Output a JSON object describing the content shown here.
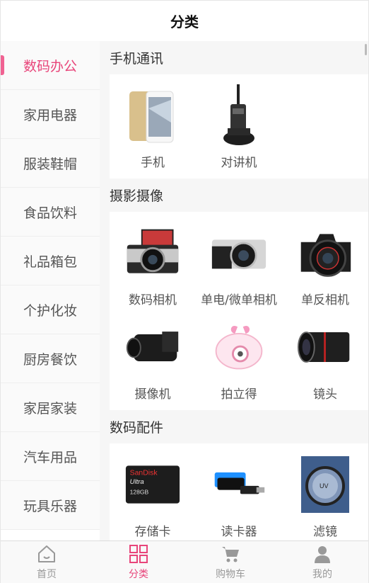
{
  "header": {
    "title": "分类"
  },
  "sidebar": {
    "items": [
      {
        "label": "数码办公",
        "active": true
      },
      {
        "label": "家用电器"
      },
      {
        "label": "服装鞋帽"
      },
      {
        "label": "食品饮料"
      },
      {
        "label": "礼品箱包"
      },
      {
        "label": "个护化妆"
      },
      {
        "label": "厨房餐饮"
      },
      {
        "label": "家居家装"
      },
      {
        "label": "汽车用品"
      },
      {
        "label": "玩具乐器"
      }
    ]
  },
  "sections": [
    {
      "title": "手机通讯",
      "items": [
        {
          "label": "手机",
          "icon": "smartphone-image"
        },
        {
          "label": "对讲机",
          "icon": "walkie-talkie-image"
        }
      ]
    },
    {
      "title": "摄影摄像",
      "items": [
        {
          "label": "数码相机",
          "icon": "digital-camera-image"
        },
        {
          "label": "单电/微单相机",
          "icon": "mirrorless-camera-image"
        },
        {
          "label": "单反相机",
          "icon": "dslr-camera-image"
        },
        {
          "label": "摄像机",
          "icon": "camcorder-image"
        },
        {
          "label": "拍立得",
          "icon": "instant-camera-image"
        },
        {
          "label": "镜头",
          "icon": "lens-image"
        }
      ]
    },
    {
      "title": "数码配件",
      "items": [
        {
          "label": "存储卡",
          "icon": "memory-card-image",
          "card_text": [
            "SanDisk",
            "Ultra",
            "128GB"
          ]
        },
        {
          "label": "读卡器",
          "icon": "card-reader-image"
        },
        {
          "label": "滤镜",
          "icon": "lens-filter-image",
          "filter_text": "UV"
        }
      ]
    }
  ],
  "tabbar": {
    "items": [
      {
        "label": "首页",
        "icon": "home-icon"
      },
      {
        "label": "分类",
        "icon": "category-grid-icon",
        "active": true
      },
      {
        "label": "购物车",
        "icon": "shopping-cart-icon"
      },
      {
        "label": "我的",
        "icon": "user-icon"
      }
    ]
  },
  "colors": {
    "accent": "#e8457a",
    "inactive": "#999999",
    "background": "#f6f6f6"
  }
}
